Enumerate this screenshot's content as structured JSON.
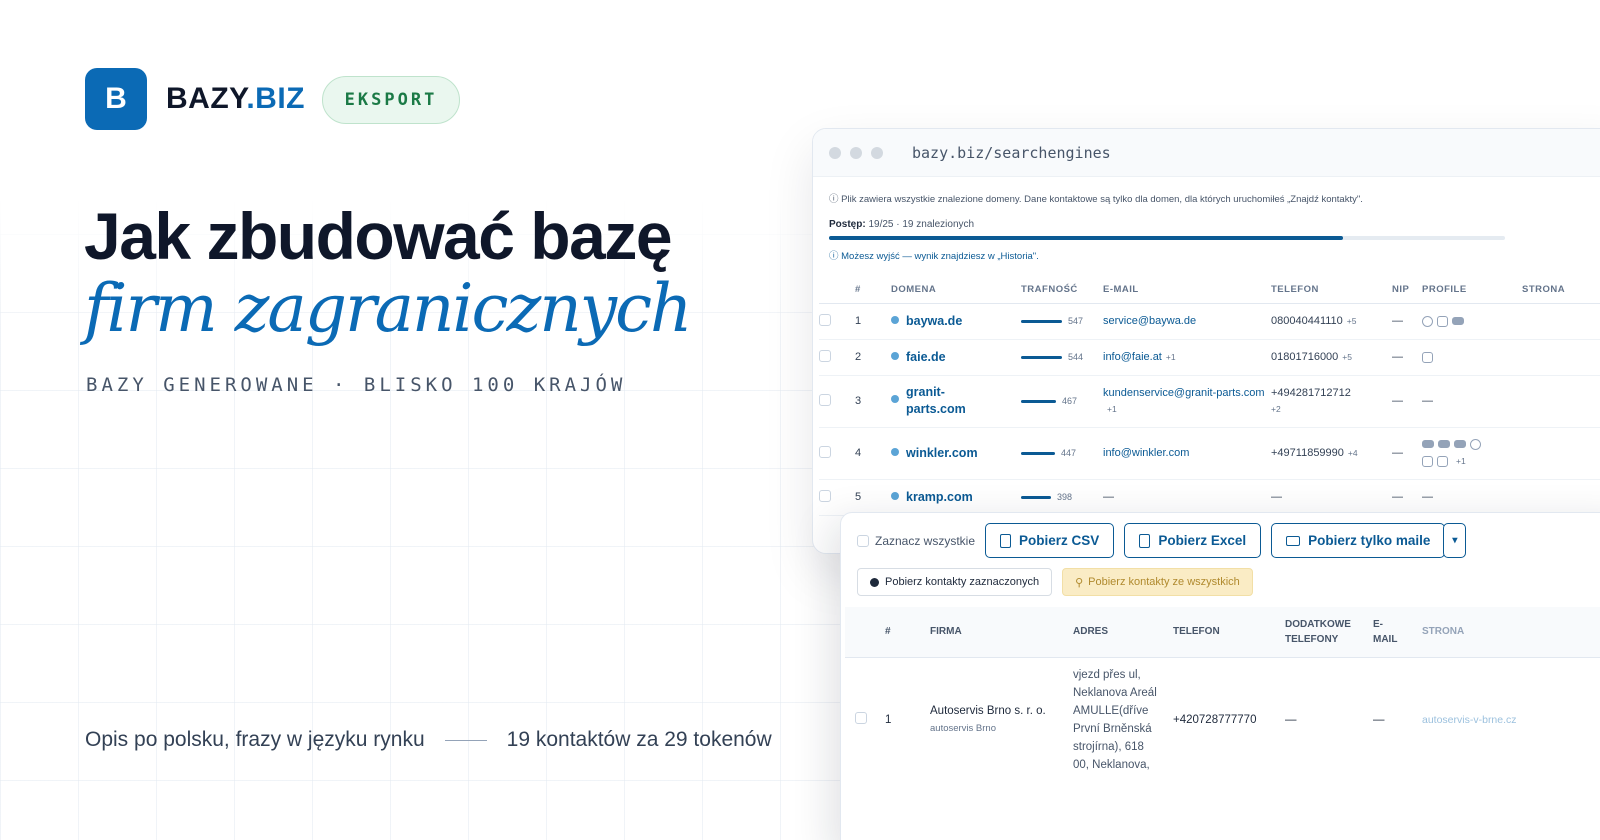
{
  "brand": {
    "tile_letter": "B",
    "name": "BAZY",
    "tld": ".BIZ",
    "badge": "EKSPORT"
  },
  "headline": {
    "line1": "Jak zbudować bazę",
    "line2": "firm zagranicznych",
    "kicker": "BAZY GENEROWANE · BLISKO 100 KRAJÓW"
  },
  "footer": {
    "left": "Opis po polsku, frazy w języku rynku",
    "right": "19 kontaktów za 29 tokenów"
  },
  "colors": {
    "brand": "#0b6ab5",
    "badge_bg": "#eaf7ef",
    "badge_text": "#1b7a46",
    "gold": "#faecc5"
  },
  "browser": {
    "url": "bazy.biz/searchengines",
    "info": "ⓘ Plik zawiera wszystkie znalezione domeny. Dane kontaktowe są tylko dla domen, dla których uruchomiłeś „Znajdź kontakty\".",
    "progress_label": "Postęp:",
    "progress_text": "19/25 · 19 znalezionych",
    "progress_fraction": 0.76,
    "note": "ⓘ Możesz wyjść — wynik znajdziesz w „Historia\".",
    "columns": {
      "num": "#",
      "domain": "DOMENA",
      "score": "TRAFNOŚĆ",
      "email": "E-MAIL",
      "phone": "TELEFON",
      "nip": "NIP",
      "profiles": "PROFILE",
      "site": "STRONA"
    },
    "rows": [
      {
        "num": "1",
        "domain": "baywa.de",
        "score": "547",
        "score_frac": 0.75,
        "email": "service@baywa.de",
        "email_extra": "",
        "phone": "080040441110",
        "phone_extra": "+5",
        "nip": "—",
        "profiles": [
          "facebook-icon",
          "instagram-icon",
          "youtube-icon"
        ]
      },
      {
        "num": "2",
        "domain": "faie.de",
        "score": "544",
        "score_frac": 0.74,
        "email": "info@faie.at",
        "email_extra": "+1",
        "phone": "01801716000",
        "phone_extra": "+5",
        "nip": "—",
        "profiles": [
          "instagram-icon"
        ]
      },
      {
        "num": "3",
        "domain": "granit-parts.com",
        "score": "467",
        "score_frac": 0.64,
        "email": "kundenservice@granit-parts.com",
        "email_extra": "+1",
        "phone": "+494281712712",
        "phone_extra": "+2",
        "nip": "—",
        "profiles_text": "—"
      },
      {
        "num": "4",
        "domain": "winkler.com",
        "score": "447",
        "score_frac": 0.61,
        "email": "info@winkler.com",
        "email_extra": "",
        "phone": "+49711859990",
        "phone_extra": "+4",
        "nip": "—",
        "profiles": [
          "youtube-icon",
          "youtube-icon",
          "youtube-icon",
          "facebook-icon",
          "instagram-icon",
          "instagram-icon"
        ],
        "profiles_more": "+1"
      },
      {
        "num": "5",
        "domain": "kramp.com",
        "score": "398",
        "score_frac": 0.55,
        "email_text": "—",
        "phone_text": "—",
        "nip": "—",
        "profiles_text": "—"
      }
    ]
  },
  "panel": {
    "select_all": "Zaznacz wszystkie",
    "btn_csv": "Pobierz CSV",
    "btn_excel": "Pobierz Excel",
    "btn_mails": "Pobierz tylko maile",
    "btn_contacts_selected": "Pobierz kontakty zaznaczonych",
    "btn_contacts_all": "Pobierz kontakty ze wszystkich",
    "columns": {
      "num": "#",
      "firm": "FIRMA",
      "address": "ADRES",
      "phone": "TELEFON",
      "extra_phones_1": "DODATKOWE",
      "extra_phones_2": "TELEFONY",
      "email_1": "E-",
      "email_2": "MAIL",
      "site": "STRONA"
    },
    "row": {
      "num": "1",
      "firm": "Autoservis Brno s. r. o.",
      "firm_sub": "autoservis Brno",
      "address": "vjezd přes ul, Neklanova Areál AMULLE(dříve První Brněnská strojírna), 618 00, Neklanova,",
      "phone": "+420728777770",
      "extra_phones": "—",
      "email": "—",
      "site": "autoservis-v-brne.cz"
    }
  }
}
